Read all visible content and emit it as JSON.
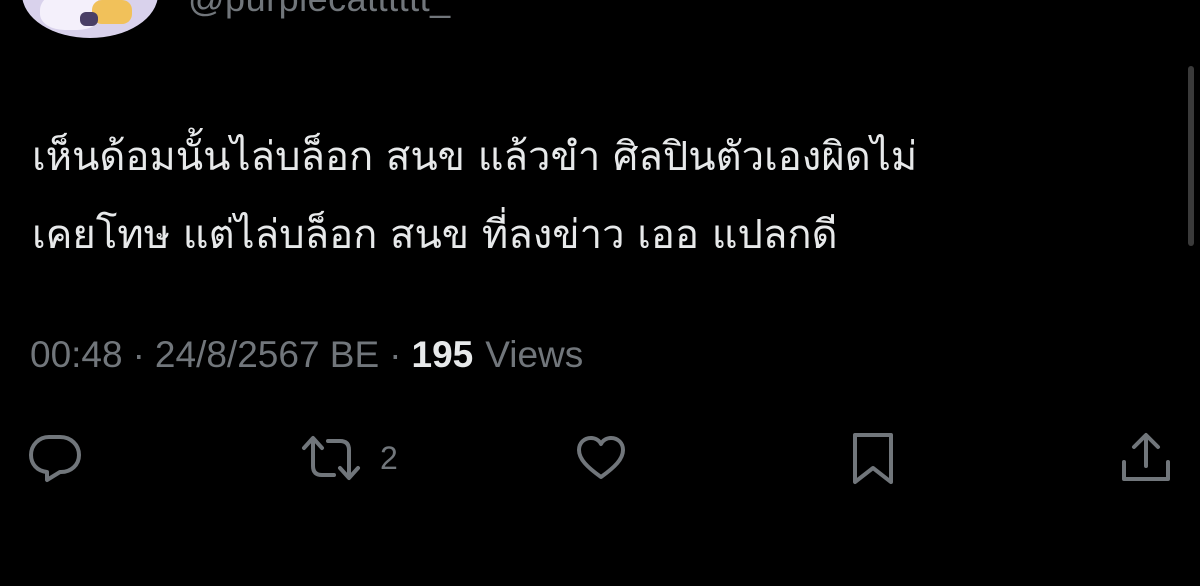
{
  "author": {
    "handle": "@purplecatttttt_"
  },
  "tweet": {
    "lines": [
      "เห็นด้อมนั้นไล่บล็อก สนข แล้วขำ ศิลปินตัวเองผิดไม่",
      "เคยโทษ แต่ไล่บล็อก สนข ที่ลงข่าว เออ แปลกดี"
    ],
    "time": "00:48",
    "separator": "·",
    "date": "24/8/2567 BE",
    "views_count": "195",
    "views_label": "Views"
  },
  "actions": {
    "reply_count": "",
    "retweet_count": "2",
    "like_count": "",
    "icons": [
      "reply-icon",
      "retweet-icon",
      "like-icon",
      "bookmark-icon",
      "share-icon"
    ]
  },
  "colors": {
    "background": "#000000",
    "text": "#e7e9ea",
    "muted": "#71767b"
  }
}
